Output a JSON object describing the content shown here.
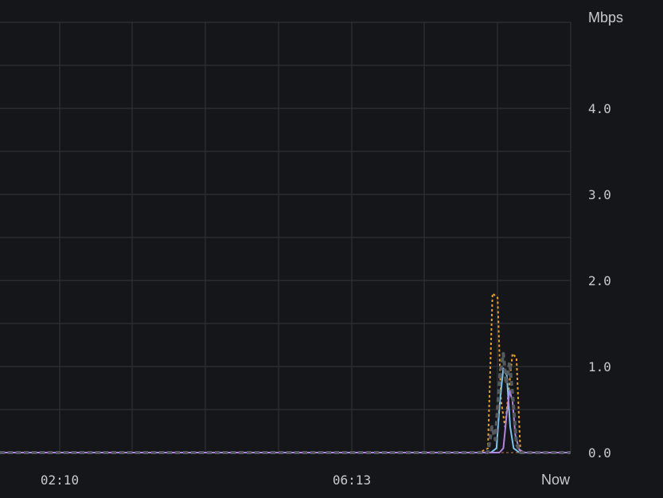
{
  "chart_data": {
    "type": "line",
    "ylabel": "Mbps",
    "ylim": [
      0,
      5
    ],
    "yticks": [
      "0.0",
      "1.0",
      "2.0",
      "3.0",
      "4.0"
    ],
    "xticks": [
      "02:10",
      "06:13",
      "Now"
    ],
    "grid": true,
    "series": [
      {
        "color": "#e8a030",
        "style": "dotted",
        "points": [
          [
            0,
            0
          ],
          [
            0.84,
            0
          ],
          [
            0.855,
            0.05
          ],
          [
            0.863,
            1.85
          ],
          [
            0.872,
            1.8
          ],
          [
            0.878,
            0.6
          ],
          [
            0.885,
            0.3
          ],
          [
            0.898,
            1.15
          ],
          [
            0.905,
            1.1
          ],
          [
            0.912,
            0
          ],
          [
            1,
            0
          ]
        ]
      },
      {
        "color": "#7fc3e8",
        "style": "solid",
        "points": [
          [
            0,
            0
          ],
          [
            0.86,
            0
          ],
          [
            0.87,
            0.05
          ],
          [
            0.876,
            0.6
          ],
          [
            0.882,
            0.98
          ],
          [
            0.888,
            0.9
          ],
          [
            0.894,
            0.3
          ],
          [
            0.9,
            0.05
          ],
          [
            0.91,
            0
          ],
          [
            1,
            0
          ]
        ]
      },
      {
        "color": "#b084e0",
        "style": "solid",
        "points": [
          [
            0,
            0
          ],
          [
            0.875,
            0
          ],
          [
            0.882,
            0.05
          ],
          [
            0.888,
            0.45
          ],
          [
            0.893,
            0.72
          ],
          [
            0.898,
            0.6
          ],
          [
            0.903,
            0.2
          ],
          [
            0.91,
            0.03
          ],
          [
            0.92,
            0
          ],
          [
            1,
            0
          ]
        ]
      },
      {
        "color": "#555a60",
        "style": "dashed",
        "points": [
          [
            0,
            0
          ],
          [
            0.855,
            0
          ],
          [
            0.862,
            0.3
          ],
          [
            0.868,
            0.15
          ],
          [
            0.876,
            0.9
          ],
          [
            0.882,
            1.15
          ],
          [
            0.887,
            0.8
          ],
          [
            0.893,
            1.05
          ],
          [
            0.899,
            0.6
          ],
          [
            0.905,
            0.1
          ],
          [
            0.912,
            0
          ],
          [
            1,
            0
          ]
        ]
      }
    ]
  }
}
